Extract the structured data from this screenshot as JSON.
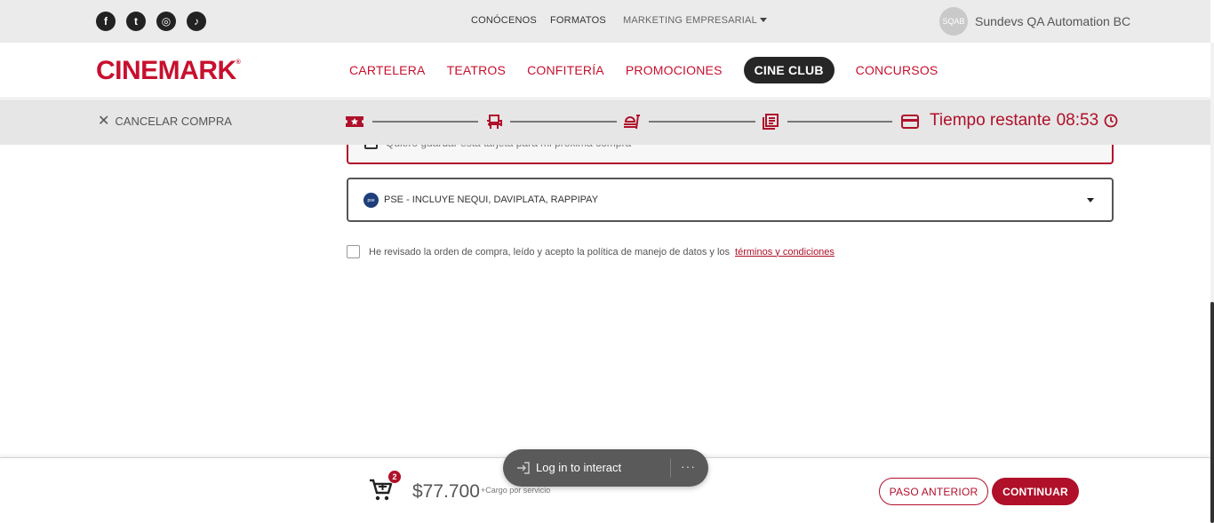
{
  "topbar": {
    "social": [
      {
        "icon": "facebook-icon",
        "glyph": "f"
      },
      {
        "icon": "twitter-icon",
        "glyph": "t"
      },
      {
        "icon": "instagram-icon",
        "glyph": "◎"
      },
      {
        "icon": "tiktok-icon",
        "glyph": "♪"
      }
    ],
    "links": [
      "CONÓCENOS",
      "FORMATOS",
      "MARKETING EMPRESARIAL"
    ],
    "user": {
      "initials": "SQAB",
      "name": "Sundevs QA Automation BC"
    }
  },
  "brand": {
    "name": "CINEMARK",
    "mark": "®"
  },
  "nav": [
    "CARTELERA",
    "TEATROS",
    "CONFITERÍA",
    "PROMOCIONES",
    "CINE CLUB",
    "CONCURSOS"
  ],
  "progress": {
    "cancel_label": "CANCELAR COMPRA",
    "steps": [
      "ticket-icon",
      "seat-icon",
      "food-icon",
      "summary-icon",
      "card-icon"
    ],
    "timer_label": "Tiempo restante",
    "timer_value": "08:53"
  },
  "payment": {
    "save_card_label": "Quiero guardar esta tarjeta para mi próxima compra",
    "pse_logo": "pse",
    "method_value": "PSE - INCLUYE NEQUI, DAVIPLATA, RAPPIPAY",
    "terms_text": "He revisado la orden de compra, leído y acepto la política de manejo de datos y los",
    "terms_link": "términos y condiciones"
  },
  "footer": {
    "cart_count": "2",
    "price": "$77.700",
    "fee_note": "+Cargo por servicio",
    "back_label": "PASO ANTERIOR",
    "continue_label": "CONTINUAR"
  },
  "overlay": {
    "label": "Log in to interact",
    "more": "···"
  },
  "colors": {
    "brand": "#c8102e",
    "accent": "#b0102a",
    "dark": "#262626",
    "topbar_bg": "#ebebeb",
    "progress_bg": "#e6e6e6"
  }
}
